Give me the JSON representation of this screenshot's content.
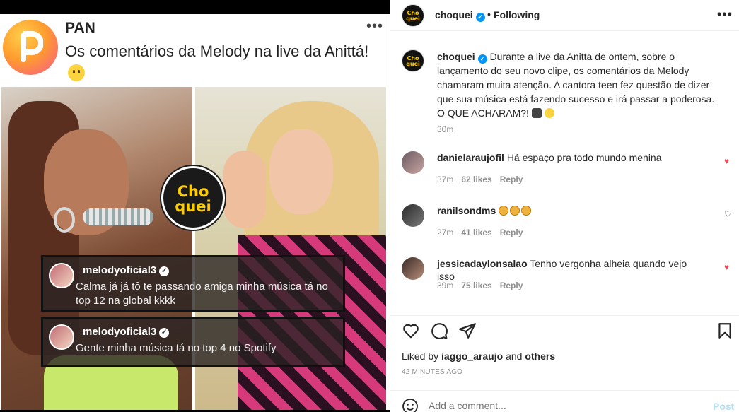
{
  "media": {
    "brand": "PAN",
    "headline": "Os comentários da Melody na live da Anittá!",
    "stamp_line1": "Cho",
    "stamp_line2": "quei",
    "bubbles": [
      {
        "user": "melodyoficial3",
        "text": "Calma já já tô te passando amiga minha música tá no top 12 na global kkkk"
      },
      {
        "user": "melodyoficial3",
        "text": "Gente minha música tá no top 4 no Spotify"
      }
    ]
  },
  "header": {
    "username": "choquei",
    "separator": "•",
    "follow_label": "Following",
    "more": "•••",
    "avatar_line1": "Cho",
    "avatar_line2": "quei"
  },
  "caption": {
    "username": "choquei",
    "text": "Durante a live da Anitta de ontem, sobre o lançamento do seu novo clipe, os comentários da Melody chamaram muita atenção. A cantora teen fez questão de dizer que sua música está fazendo sucesso e irá passar a poderosa. O QUE ACHARAM?!",
    "time": "30m"
  },
  "comments": [
    {
      "username": "danielaraujofil",
      "text": "Há espaço pra todo mundo menina",
      "time": "37m",
      "likes": "62 likes",
      "reply": "Reply",
      "liked": true
    },
    {
      "username": "ranilsondms",
      "text": "",
      "time": "27m",
      "likes": "41 likes",
      "reply": "Reply",
      "liked": false
    },
    {
      "username": "jessicadaylonsalao",
      "text": "Tenho vergonha alheia quando vejo isso",
      "time": "39m",
      "likes": "75 likes",
      "reply": "Reply",
      "liked": true
    }
  ],
  "likes_line": {
    "prefix": "Liked by",
    "user": "iaggo_araujo",
    "mid": "and",
    "others": "others"
  },
  "posted_ago": "42 MINUTES AGO",
  "add_comment": {
    "placeholder": "Add a comment...",
    "post_label": "Post"
  },
  "colors": {
    "verified": "#0095f6",
    "heart": "#ed4956",
    "post_disabled": "#b2dffc",
    "brand_yellow": "#ffcc00"
  },
  "icons": [
    "heart-icon",
    "comment-icon",
    "share-icon",
    "bookmark-icon",
    "emoji-icon",
    "more-icon"
  ]
}
